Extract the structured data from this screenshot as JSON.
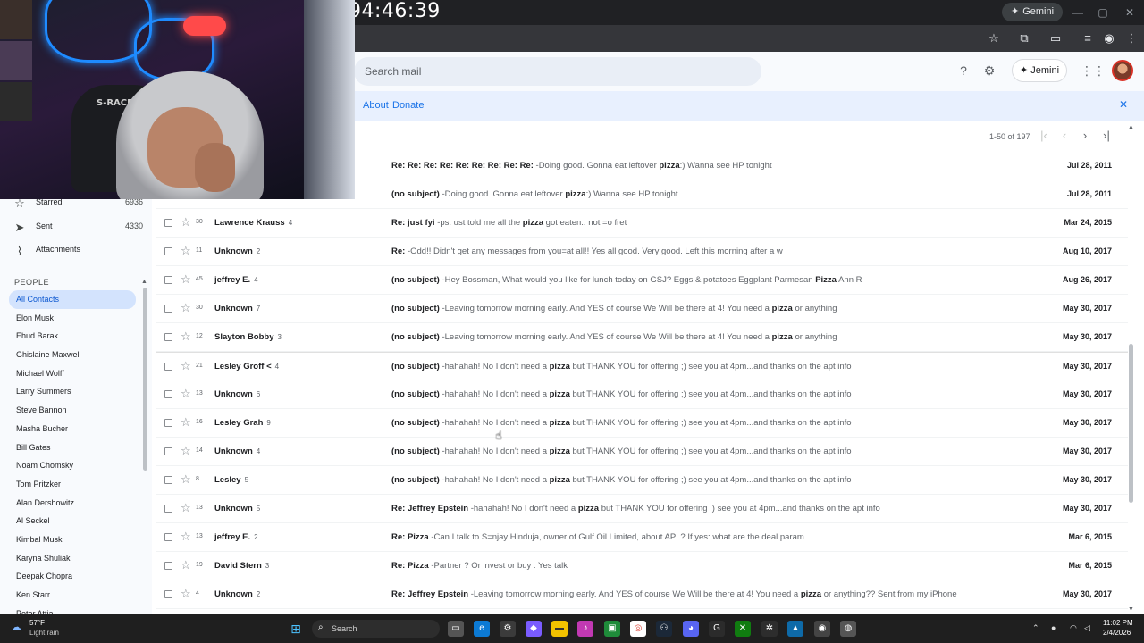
{
  "stream": {
    "timer": "94:46:39"
  },
  "browser": {
    "gemini_label": "Gemini"
  },
  "header": {
    "search_placeholder": "Search mail",
    "jemini_label": "Jemini"
  },
  "banner": {
    "about": "About",
    "donate": "Donate"
  },
  "pagination": {
    "range": "1-50 of 197"
  },
  "sidebar": {
    "nav": [
      {
        "label": "Starred",
        "count": "6936",
        "icon": "star-icon"
      },
      {
        "label": "Sent",
        "count": "4330",
        "icon": "send-icon"
      },
      {
        "label": "Attachments",
        "count": "",
        "icon": "paperclip-icon"
      }
    ],
    "people_heading": "PEOPLE",
    "contacts": [
      "All Contacts",
      "Elon Musk",
      "Ehud Barak",
      "Ghislaine Maxwell",
      "Michael Wolff",
      "Larry Summers",
      "Steve Bannon",
      "Masha Bucher",
      "Bill Gates",
      "Noam Chomsky",
      "Tom Pritzker",
      "Alan Dershowitz",
      "Al Seckel",
      "Kimbal Musk",
      "Karyna Shuliak",
      "Deepak Chopra",
      "Ken Starr",
      "Peter Attia"
    ]
  },
  "emails": [
    {
      "num": "",
      "sender": "",
      "count": "",
      "subject": "Re: Re: Re: Re: Re: Re: Re: Re: Re:",
      "pre": " -Doing good. Gonna eat leftover ",
      "kw": "pizza",
      "post": ":) Wanna see HP tonight",
      "date": "Jul 28, 2011"
    },
    {
      "num": "",
      "sender": "",
      "count": "",
      "subject": "(no subject)",
      "pre": " -Doing good. Gonna eat leftover ",
      "kw": "pizza",
      "post": ":) Wanna see HP tonight",
      "date": "Jul 28, 2011"
    },
    {
      "num": "30",
      "sender": "Lawrence Krauss",
      "count": "4",
      "subject": "Re: just fyi",
      "pre": " -ps. ust told me all the ",
      "kw": "pizza",
      "post": " got eaten.. not =o fret",
      "date": "Mar 24, 2015"
    },
    {
      "num": "11",
      "sender": "Unknown",
      "count": "2",
      "subject": "Re:",
      "pre": " -Odd!! Didn't get any messages from you=at all!! Yes all good. Very good. Left this morning after a w",
      "kw": "",
      "post": "",
      "date": "Aug 10, 2017"
    },
    {
      "num": "45",
      "sender": "jeffrey E.",
      "count": "4",
      "subject": "(no subject)",
      "pre": " -Hey Bossman, What would you like for lunch today on GSJ? Eggs & potatoes Eggplant Parmesan ",
      "kw": "Pizza",
      "post": " Ann R",
      "date": "Aug 26, 2017"
    },
    {
      "num": "30",
      "sender": "Unknown",
      "count": "7",
      "subject": "(no subject)",
      "pre": " -Leaving tomorrow morning early. And YES of course We Will be there at 4! You need a ",
      "kw": "pizza",
      "post": " or anything",
      "date": "May 30, 2017"
    },
    {
      "num": "12",
      "sender": "Slayton Bobby",
      "count": "3",
      "subject": "(no subject)",
      "pre": " -Leaving tomorrow morning early. And YES of course We Will be there at 4! You need a ",
      "kw": "pizza",
      "post": " or anything",
      "date": "May 30, 2017"
    },
    {
      "num": "21",
      "sender": "Lesley Groff <",
      "count": "4",
      "subject": "(no subject)",
      "pre": " -hahahah! No I don't need a ",
      "kw": "pizza",
      "post": " but THANK YOU for offering ;) see you at 4pm...and thanks on the apt info",
      "date": "May 30, 2017"
    },
    {
      "num": "13",
      "sender": "Unknown",
      "count": "6",
      "subject": "(no subject)",
      "pre": " -hahahah! No I don't need a ",
      "kw": "pizza",
      "post": " but THANK YOU for offering ;) see you at 4pm...and thanks on the apt info",
      "date": "May 30, 2017"
    },
    {
      "num": "16",
      "sender": "Lesley Grah",
      "count": "9",
      "subject": "(no subject)",
      "pre": " -hahahah! No I don't need a ",
      "kw": "pizza",
      "post": " but THANK YOU for offering ;) see you at 4pm...and thanks on the apt info",
      "date": "May 30, 2017"
    },
    {
      "num": "14",
      "sender": "Unknown",
      "count": "4",
      "subject": "(no subject)",
      "pre": " -hahahah! No I don't need a ",
      "kw": "pizza",
      "post": " but THANK YOU for offering ;) see you at 4pm...and thanks on the apt info",
      "date": "May 30, 2017"
    },
    {
      "num": "8",
      "sender": "Lesley",
      "count": "5",
      "subject": "(no subject)",
      "pre": " -hahahah! No I don't need a ",
      "kw": "pizza",
      "post": " but THANK YOU for offering ;) see you at 4pm...and thanks on the apt info",
      "date": "May 30, 2017"
    },
    {
      "num": "13",
      "sender": "Unknown",
      "count": "5",
      "subject": "Re: Jeffrey Epstein",
      "pre": " -hahahah! No I don't need a ",
      "kw": "pizza",
      "post": " but THANK YOU for offering ;) see you at 4pm...and thanks on the apt info",
      "date": "May 30, 2017"
    },
    {
      "num": "13",
      "sender": "jeffrey E.",
      "count": "2",
      "subject": "Re: Pizza",
      "pre": " -Can I talk to S=njay Hinduja, owner of Gulf Oil Limited, about API ? If yes: what are the deal param",
      "kw": "",
      "post": "",
      "date": "Mar 6, 2015"
    },
    {
      "num": "19",
      "sender": "David Stern",
      "count": "3",
      "subject": "Re: Pizza",
      "pre": " -Partner ? Or invest or buy . Yes talk",
      "kw": "",
      "post": "",
      "date": "Mar 6, 2015"
    },
    {
      "num": "4",
      "sender": "Unknown",
      "count": "2",
      "subject": "Re: Jeffrey Epstein",
      "pre": " -Leaving tomorrow morning early. And YES of course We Will be there at 4! You need a ",
      "kw": "pizza",
      "post": " or anything?? Sent from my iPhone",
      "date": "May 30, 2017"
    }
  ],
  "webcam": {
    "chair_text": "S-RACER"
  },
  "taskbar": {
    "weather_temp": "57°F",
    "weather_desc": "Light rain",
    "search_label": "Search",
    "time": "11:02 PM",
    "date": "2/4/2026"
  }
}
